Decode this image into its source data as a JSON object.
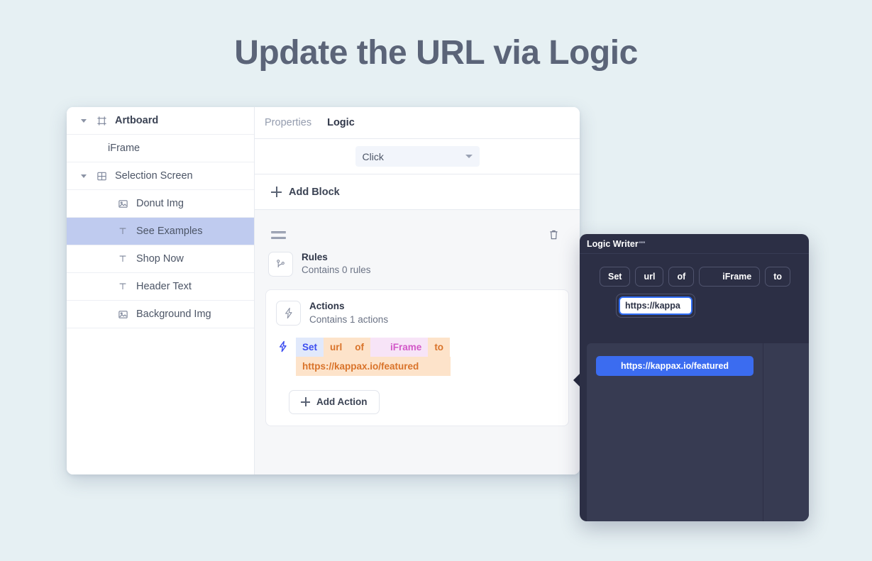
{
  "page": {
    "title": "Update the URL via Logic",
    "background_color": "#e6f0f3",
    "title_color": "#5b6478"
  },
  "sidebar": {
    "items": [
      {
        "label": "Artboard",
        "icon": "artboard-icon",
        "caret": true,
        "depth": 0,
        "selected": false,
        "bold": true
      },
      {
        "label": "iFrame",
        "icon": "none",
        "caret": false,
        "depth": 1,
        "selected": false,
        "bold": false
      },
      {
        "label": "Selection Screen",
        "icon": "frame-icon",
        "caret": true,
        "depth": 0,
        "selected": false,
        "bold": false
      },
      {
        "label": "Donut Img",
        "icon": "image-icon",
        "caret": false,
        "depth": 1,
        "selected": false,
        "bold": false
      },
      {
        "label": "See Examples",
        "icon": "text-icon",
        "caret": false,
        "depth": 1,
        "selected": true,
        "bold": false
      },
      {
        "label": "Shop Now",
        "icon": "text-icon",
        "caret": false,
        "depth": 1,
        "selected": false,
        "bold": false
      },
      {
        "label": "Header Text",
        "icon": "text-icon",
        "caret": false,
        "depth": 1,
        "selected": false,
        "bold": false
      },
      {
        "label": "Background Img",
        "icon": "image-icon",
        "caret": false,
        "depth": 1,
        "selected": false,
        "bold": false
      }
    ],
    "selected_highlight_color": "#bfcbef"
  },
  "pane": {
    "tabs": [
      {
        "label": "Properties",
        "active": false
      },
      {
        "label": "Logic",
        "active": true
      }
    ],
    "trigger_select": {
      "value": "Click",
      "icon": "chevron-down-icon"
    },
    "add_block_label": "Add Block",
    "block": {
      "drag_handle_icon": "drag-handle-icon",
      "delete_icon": "trash-icon",
      "rules": {
        "icon": "branch-icon",
        "title": "Rules",
        "subtitle": "Contains 0 rules"
      },
      "actions": {
        "icon": "bolt-icon",
        "title": "Actions",
        "subtitle": "Contains 1 actions",
        "statement_icon": "bolt-icon",
        "tokens": [
          {
            "text": "Set",
            "style": "set"
          },
          {
            "text": "url",
            "style": "orange"
          },
          {
            "text": "of",
            "style": "orange"
          },
          {
            "text": "iFrame",
            "style": "pink"
          },
          {
            "text": "to",
            "style": "orange"
          }
        ],
        "value_token": {
          "text": "https://kappax.io/featured",
          "style": "orange"
        },
        "add_action_label": "Add Action"
      }
    }
  },
  "logic_writer": {
    "title": "Logic Writer",
    "title_superscript": "''''",
    "chips": [
      {
        "text": "Set",
        "wide": false
      },
      {
        "text": "url",
        "wide": false
      },
      {
        "text": "of",
        "wide": false
      },
      {
        "text": "iFrame",
        "wide": true
      },
      {
        "text": "to",
        "wide": false
      }
    ],
    "input": {
      "value": "https://kappa",
      "focus_color": "#2f6df6"
    },
    "suggestions": [
      {
        "label": "https://kappax.io/featured",
        "selected": true
      }
    ],
    "panel_color": "#2c2f45",
    "suggest_panel_color": "#373b52",
    "accent_color": "#3b6cf0"
  }
}
